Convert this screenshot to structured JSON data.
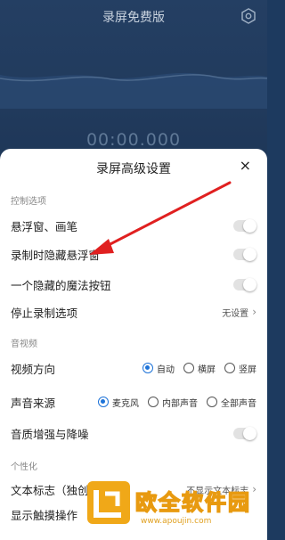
{
  "app": {
    "title": "录屏免费版",
    "timer": "00:00.000"
  },
  "sheet": {
    "title": "录屏高级设置",
    "close_label": "×",
    "sections": {
      "control": "控制选项",
      "audio_video": "音视频",
      "personalize": "个性化"
    },
    "control_rows": {
      "float_window": "悬浮窗、画笔",
      "hide_float": "录制时隐藏悬浮窗",
      "hidden_magic": "一个隐藏的魔法按钮",
      "stop_options": "停止录制选项",
      "stop_options_value": "无设置"
    },
    "video_direction": {
      "label": "视频方向",
      "options": [
        "自动",
        "横屏",
        "竖屏"
      ],
      "selected": "自动"
    },
    "audio_source": {
      "label": "声音来源",
      "options": [
        "麦克风",
        "内部声音",
        "全部声音"
      ],
      "selected": "麦克风"
    },
    "audio_enhance": "音质增强与降噪",
    "text_logo": {
      "label": "文本标志（独创防伪）",
      "value": "不显示文本标志"
    },
    "show_touches": "显示触摸操作"
  },
  "watermark": {
    "text": "欧全软件园",
    "url": "www.apoujin.com"
  },
  "colors": {
    "accent": "#1e73d8",
    "arrow": "#e02020",
    "background": "#1d3a5f"
  }
}
